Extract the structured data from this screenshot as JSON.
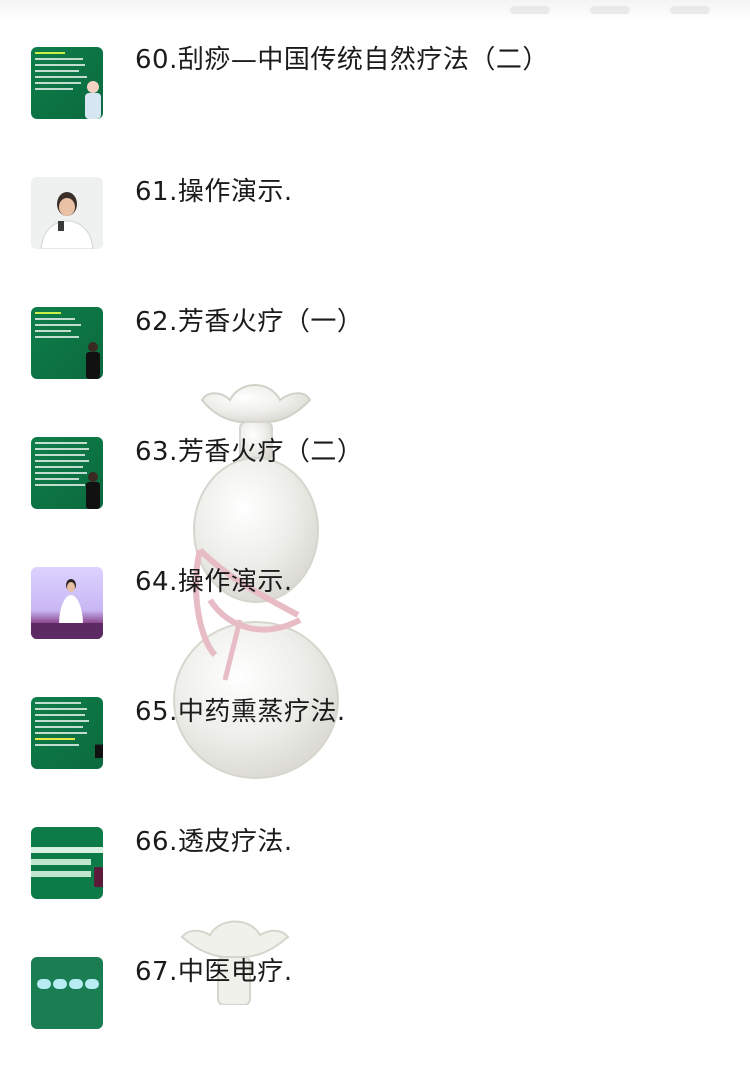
{
  "lessons": [
    {
      "number": "60.",
      "title": "刮痧—中国传统自然疗法（二）",
      "thumb": "slide-icon"
    },
    {
      "number": "61.",
      "title": "操作演示.",
      "thumb": "instructor-photo"
    },
    {
      "number": "62.",
      "title": "芳香火疗（一）",
      "thumb": "slide-icon"
    },
    {
      "number": "63.",
      "title": "芳香火疗（二）",
      "thumb": "slide-icon"
    },
    {
      "number": "64.",
      "title": "操作演示.",
      "thumb": "demo-photo"
    },
    {
      "number": "65.",
      "title": "中药熏蒸疗法.",
      "thumb": "slide-icon"
    },
    {
      "number": "66.",
      "title": "透皮疗法.",
      "thumb": "chart-slide-icon"
    },
    {
      "number": "67.",
      "title": "中医电疗.",
      "thumb": "slide-icon"
    }
  ],
  "colors": {
    "slide_green": "#0f7a46",
    "text": "#1b1b1b",
    "background": "#ffffff"
  }
}
